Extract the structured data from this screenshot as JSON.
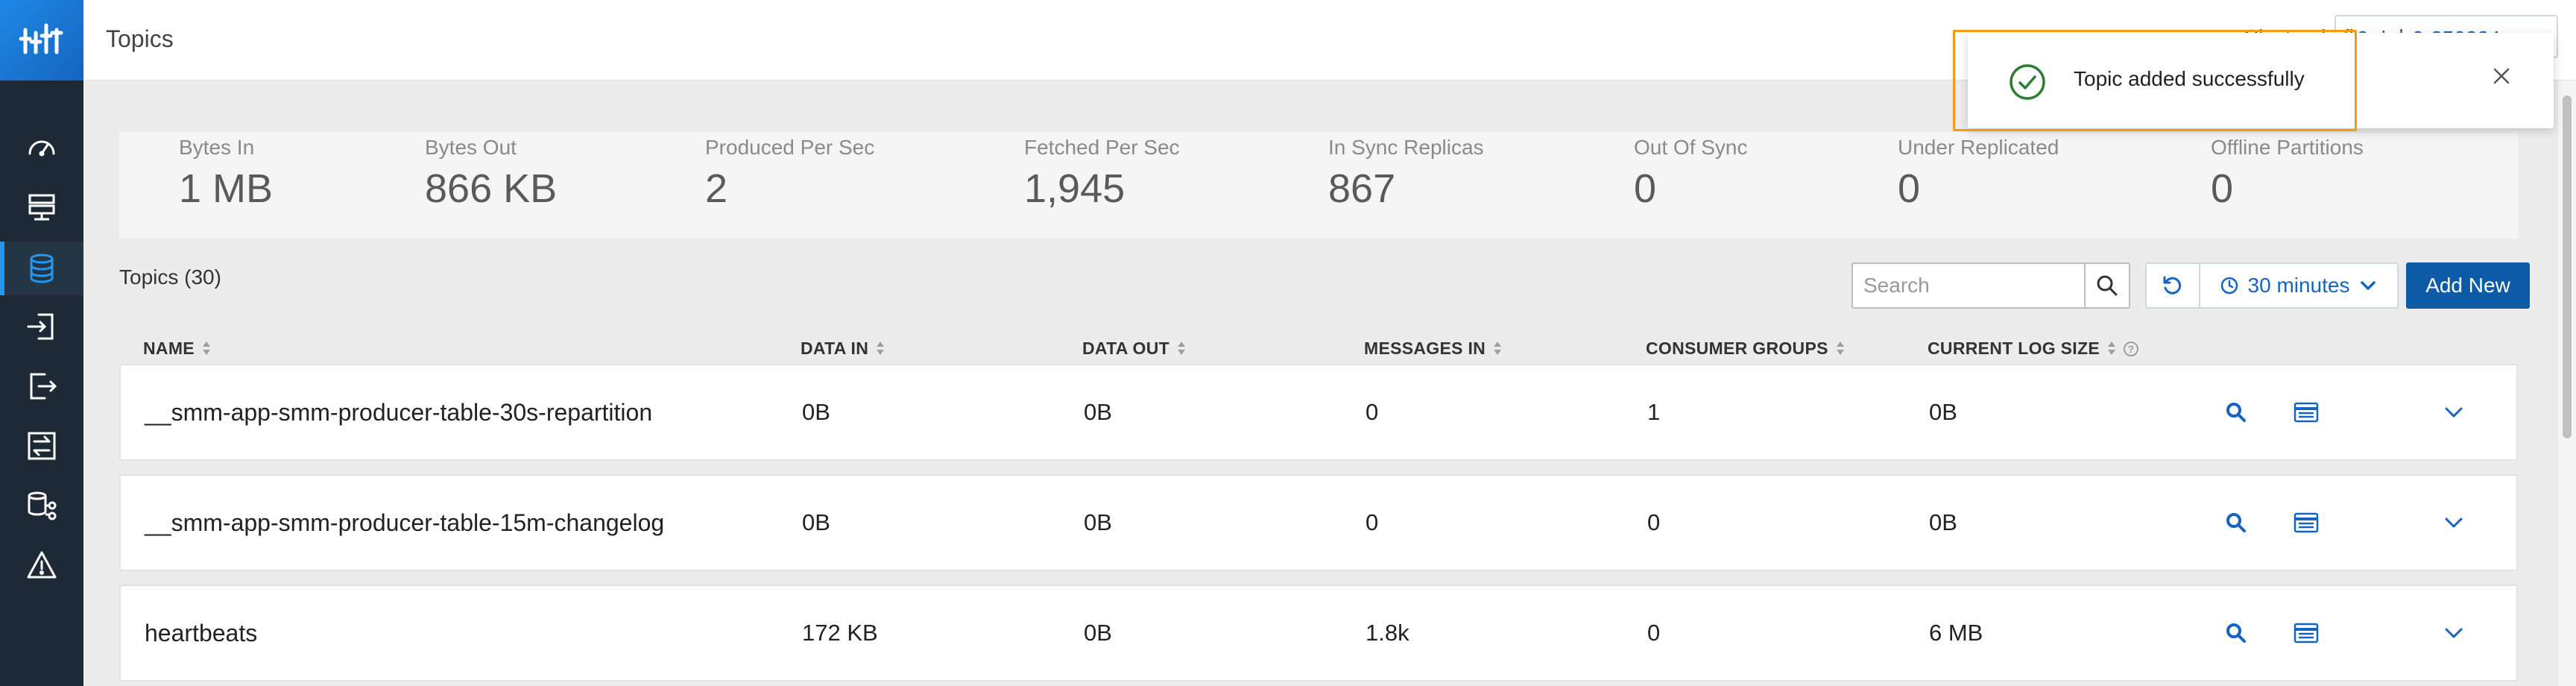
{
  "app": {
    "title": "Topics"
  },
  "header": {
    "right_text": "Cluster: kafka-ssh",
    "box_text": "0.dev.0-250224"
  },
  "toast": {
    "message": "Topic added successfully",
    "status_color": "#2e7d32",
    "highlight_color": "#f39c12"
  },
  "sidebar": {
    "items": [
      {
        "icon": "dashboard-gauge-icon",
        "active": false
      },
      {
        "icon": "brokers-server-icon",
        "active": false
      },
      {
        "icon": "topics-database-icon",
        "active": true
      },
      {
        "icon": "producers-login-icon",
        "active": false
      },
      {
        "icon": "consumers-logout-icon",
        "active": false
      },
      {
        "icon": "replication-exchange-icon",
        "active": false
      },
      {
        "icon": "data-lineage-icon",
        "active": false
      },
      {
        "icon": "alerts-warning-icon",
        "active": false
      }
    ]
  },
  "stats": [
    {
      "label": "Bytes In",
      "value": "1 MB"
    },
    {
      "label": "Bytes Out",
      "value": "866 KB"
    },
    {
      "label": "Produced Per Sec",
      "value": "2"
    },
    {
      "label": "Fetched Per Sec",
      "value": "1,945"
    },
    {
      "label": "In Sync Replicas",
      "value": "867"
    },
    {
      "label": "Out Of Sync",
      "value": "0"
    },
    {
      "label": "Under Replicated",
      "value": "0"
    },
    {
      "label": "Offline Partitions",
      "value": "0"
    }
  ],
  "toolbar": {
    "topics_count": "Topics (30)",
    "search_placeholder": "Search",
    "time_range": "30 minutes",
    "add_new_label": "Add New"
  },
  "table": {
    "columns": [
      "NAME",
      "DATA IN",
      "DATA OUT",
      "MESSAGES IN",
      "CONSUMER GROUPS",
      "CURRENT LOG SIZE"
    ],
    "help_glyph": "?",
    "rows": [
      {
        "name": "__smm-app-smm-producer-table-30s-repartition",
        "data_in": "0B",
        "data_out": "0B",
        "messages_in": "0",
        "consumer_groups": "1",
        "log_size": "0B"
      },
      {
        "name": "__smm-app-smm-producer-table-15m-changelog",
        "data_in": "0B",
        "data_out": "0B",
        "messages_in": "0",
        "consumer_groups": "0",
        "log_size": "0B"
      },
      {
        "name": "heartbeats",
        "data_in": "172 KB",
        "data_out": "0B",
        "messages_in": "1.8k",
        "consumer_groups": "0",
        "log_size": "6 MB"
      }
    ]
  },
  "colors": {
    "accent": "#1565c0",
    "primary_button": "#0d5aa7",
    "sidebar_bg": "#1d2a35"
  }
}
